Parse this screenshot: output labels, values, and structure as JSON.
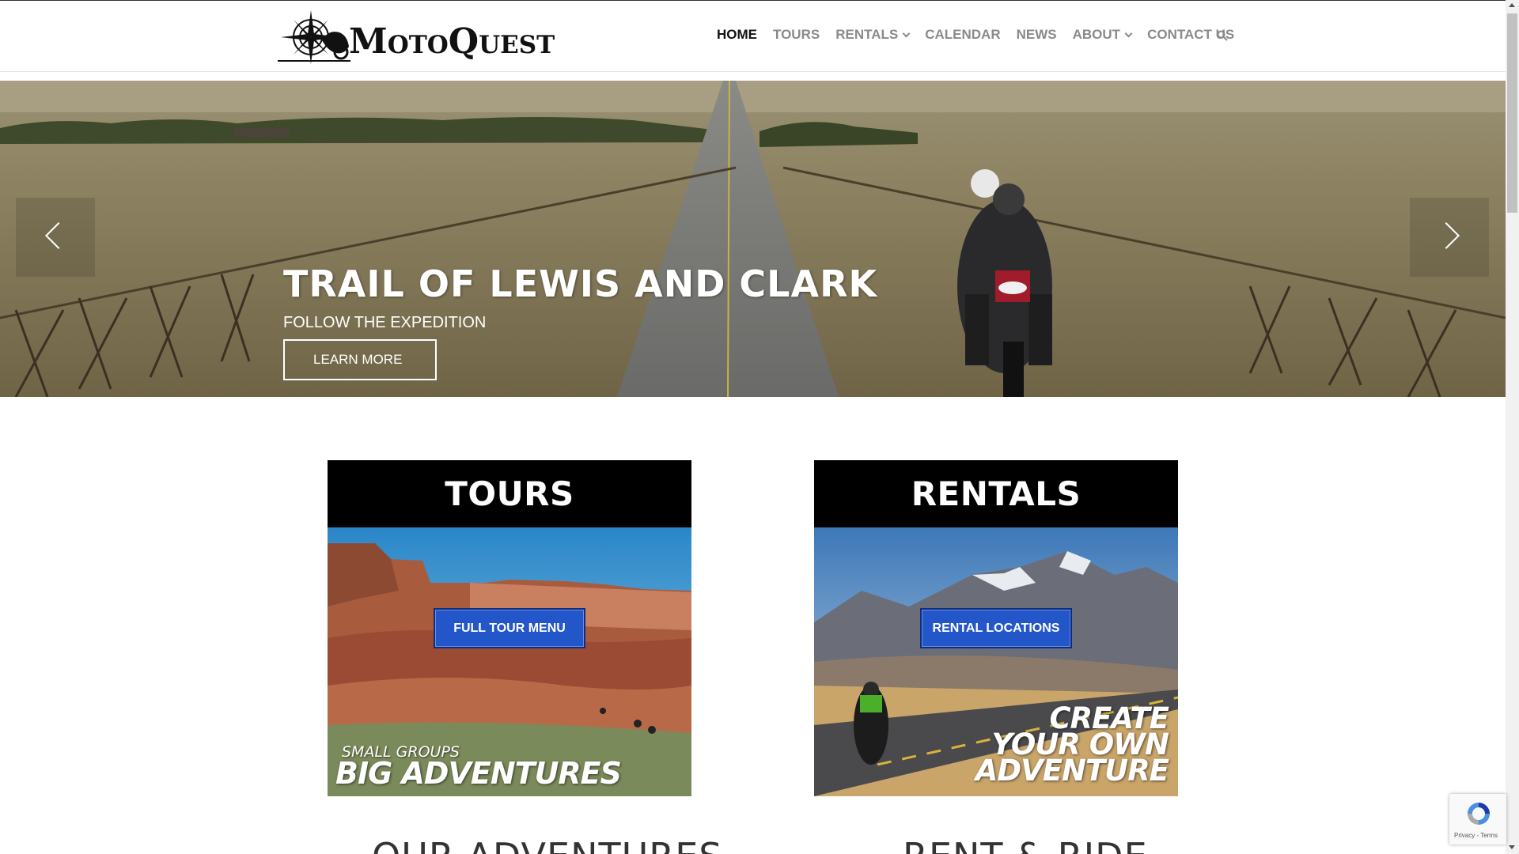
{
  "header": {
    "logo_text": "MotoQuest",
    "nav": [
      {
        "label": "HOME",
        "active": true
      },
      {
        "label": "TOURS"
      },
      {
        "label": "RENTALS",
        "dropdown": true
      },
      {
        "label": "CALENDAR"
      },
      {
        "label": "NEWS"
      },
      {
        "label": "ABOUT",
        "dropdown": true
      },
      {
        "label": "CONTACT US"
      }
    ],
    "search_icon": "search-icon"
  },
  "hero": {
    "title": "TRAIL OF LEWIS AND CLARK",
    "subtitle": "FOLLOW THE EXPEDITION",
    "button": "LEARN MORE",
    "prev_icon": "chevron-left-icon",
    "next_icon": "chevron-right-icon"
  },
  "cards": {
    "tours": {
      "heading": "TOURS",
      "button": "FULL TOUR MENU",
      "tag_small": "SMALL GROUPS",
      "tag_big": "BIG ADVENTURES"
    },
    "rentals": {
      "heading": "RENTALS",
      "button": "RENTAL LOCATIONS",
      "tag_lines": [
        "CREATE",
        "YOUR OWN",
        "ADVENTURE"
      ]
    }
  },
  "sections": {
    "left": "OUR ADVENTURES",
    "right": "RENT & RIDE"
  },
  "recaptcha": {
    "text": "Privacy - Terms"
  },
  "colors": {
    "button_blue": "#2356c8",
    "nav_active": "#111111",
    "nav_inactive": "#8a8a8a"
  }
}
